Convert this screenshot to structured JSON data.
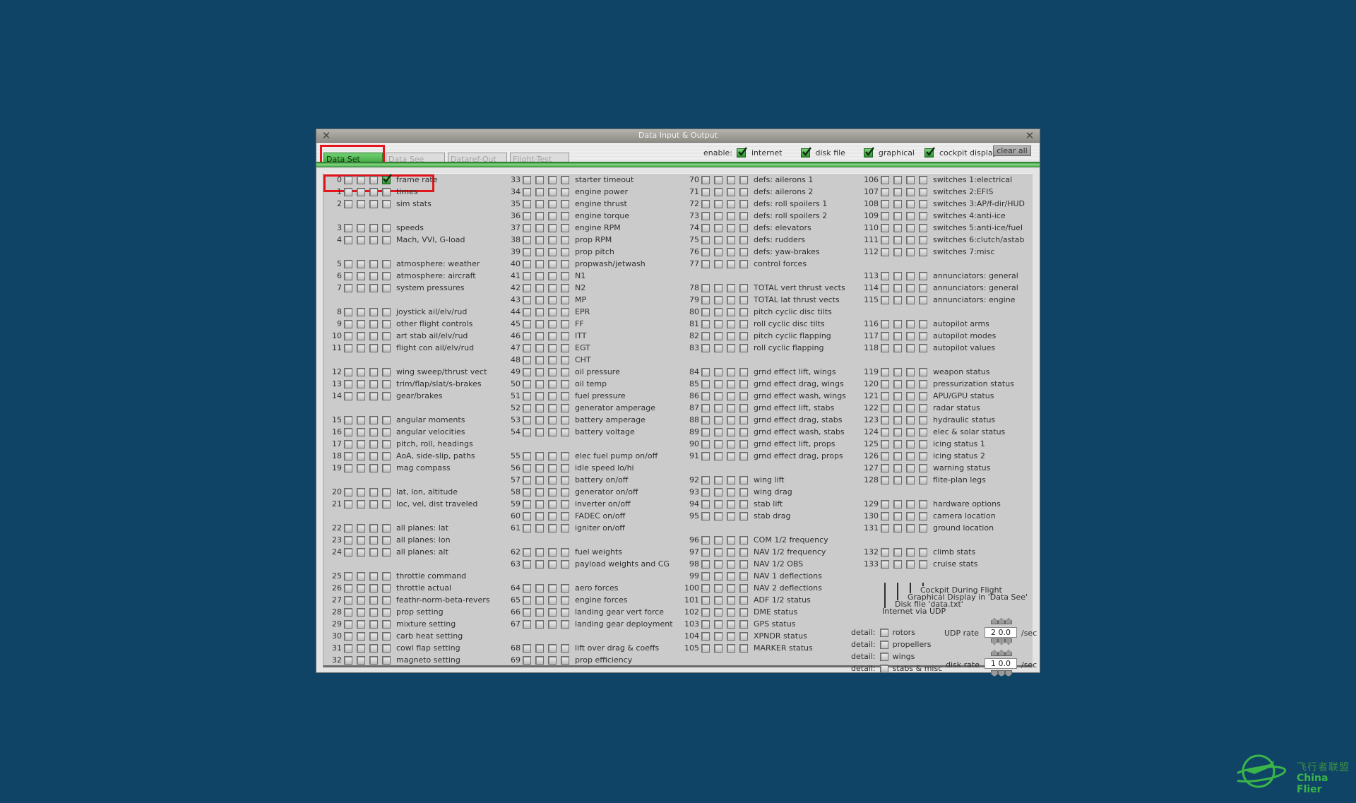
{
  "window": {
    "title": "Data Input & Output",
    "tabs": [
      {
        "label": "Data Set",
        "active": true
      },
      {
        "label": "Data See",
        "active": false
      },
      {
        "label": "Dataref-Out",
        "active": false
      },
      {
        "label": "Flight-Test",
        "active": false
      }
    ],
    "enable_label": "enable:",
    "enable_options": [
      {
        "label": "internet",
        "checked": true
      },
      {
        "label": "disk file",
        "checked": true
      },
      {
        "label": "graphical",
        "checked": true
      },
      {
        "label": "cockpit display",
        "checked": true
      }
    ],
    "clear_all_label": "clear all"
  },
  "columns": [
    {
      "slots": [
        {
          "n": "0",
          "label": "frame rate",
          "checked": [
            false,
            false,
            false,
            true
          ]
        },
        {
          "n": "1",
          "label": "times"
        },
        {
          "n": "2",
          "label": "sim stats"
        },
        null,
        {
          "n": "3",
          "label": "speeds"
        },
        {
          "n": "4",
          "label": "Mach, VVI, G-load"
        },
        null,
        {
          "n": "5",
          "label": "atmosphere: weather"
        },
        {
          "n": "6",
          "label": "atmosphere: aircraft"
        },
        {
          "n": "7",
          "label": "system pressures"
        },
        null,
        {
          "n": "8",
          "label": "joystick ail/elv/rud"
        },
        {
          "n": "9",
          "label": "other flight controls"
        },
        {
          "n": "10",
          "label": "art stab ail/elv/rud"
        },
        {
          "n": "11",
          "label": "flight con ail/elv/rud"
        },
        null,
        {
          "n": "12",
          "label": "wing sweep/thrust vect"
        },
        {
          "n": "13",
          "label": "trim/flap/slat/s-brakes"
        },
        {
          "n": "14",
          "label": "gear/brakes"
        },
        null,
        {
          "n": "15",
          "label": "angular moments"
        },
        {
          "n": "16",
          "label": "angular velocities"
        },
        {
          "n": "17",
          "label": "pitch, roll, headings"
        },
        {
          "n": "18",
          "label": "AoA, side-slip, paths"
        },
        {
          "n": "19",
          "label": "mag compass"
        },
        null,
        {
          "n": "20",
          "label": "lat, lon, altitude"
        },
        {
          "n": "21",
          "label": "loc, vel, dist traveled"
        },
        null,
        {
          "n": "22",
          "label": "all planes: lat"
        },
        {
          "n": "23",
          "label": "all planes: lon"
        },
        {
          "n": "24",
          "label": "all planes: alt"
        },
        null,
        {
          "n": "25",
          "label": "throttle command"
        },
        {
          "n": "26",
          "label": "throttle actual"
        },
        {
          "n": "27",
          "label": "feathr-norm-beta-revers"
        },
        {
          "n": "28",
          "label": "prop setting"
        },
        {
          "n": "29",
          "label": "mixture setting"
        },
        {
          "n": "30",
          "label": "carb heat setting"
        },
        {
          "n": "31",
          "label": "cowl flap setting"
        },
        {
          "n": "32",
          "label": "magneto setting"
        }
      ]
    },
    {
      "slots": [
        {
          "n": "33",
          "label": "starter timeout"
        },
        {
          "n": "34",
          "label": "engine power"
        },
        {
          "n": "35",
          "label": "engine thrust"
        },
        {
          "n": "36",
          "label": "engine torque"
        },
        {
          "n": "37",
          "label": "engine RPM"
        },
        {
          "n": "38",
          "label": "prop RPM"
        },
        {
          "n": "39",
          "label": "prop pitch"
        },
        {
          "n": "40",
          "label": "propwash/jetwash"
        },
        {
          "n": "41",
          "label": "N1"
        },
        {
          "n": "42",
          "label": "N2"
        },
        {
          "n": "43",
          "label": "MP"
        },
        {
          "n": "44",
          "label": "EPR"
        },
        {
          "n": "45",
          "label": "FF"
        },
        {
          "n": "46",
          "label": "ITT"
        },
        {
          "n": "47",
          "label": "EGT"
        },
        {
          "n": "48",
          "label": "CHT"
        },
        {
          "n": "49",
          "label": "oil pressure"
        },
        {
          "n": "50",
          "label": "oil temp"
        },
        {
          "n": "51",
          "label": "fuel pressure"
        },
        {
          "n": "52",
          "label": "generator amperage"
        },
        {
          "n": "53",
          "label": "battery amperage"
        },
        {
          "n": "54",
          "label": "battery voltage"
        },
        null,
        {
          "n": "55",
          "label": "elec fuel pump on/off"
        },
        {
          "n": "56",
          "label": "idle speed lo/hi"
        },
        {
          "n": "57",
          "label": "battery on/off"
        },
        {
          "n": "58",
          "label": "generator on/off"
        },
        {
          "n": "59",
          "label": "inverter on/off"
        },
        {
          "n": "60",
          "label": "FADEC on/off"
        },
        {
          "n": "61",
          "label": "igniter on/off"
        },
        null,
        {
          "n": "62",
          "label": "fuel weights"
        },
        {
          "n": "63",
          "label": "payload weights and CG"
        },
        null,
        {
          "n": "64",
          "label": "aero forces"
        },
        {
          "n": "65",
          "label": "engine forces"
        },
        {
          "n": "66",
          "label": "landing gear vert force"
        },
        {
          "n": "67",
          "label": "landing gear deployment"
        },
        null,
        {
          "n": "68",
          "label": "lift over drag & coeffs"
        },
        {
          "n": "69",
          "label": "prop efficiency"
        }
      ]
    },
    {
      "slots": [
        {
          "n": "70",
          "label": "defs: ailerons 1"
        },
        {
          "n": "71",
          "label": "defs: ailerons 2"
        },
        {
          "n": "72",
          "label": "defs: roll spoilers 1"
        },
        {
          "n": "73",
          "label": "defs: roll spoilers 2"
        },
        {
          "n": "74",
          "label": "defs: elevators"
        },
        {
          "n": "75",
          "label": "defs: rudders"
        },
        {
          "n": "76",
          "label": "defs: yaw-brakes"
        },
        {
          "n": "77",
          "label": "control forces"
        },
        null,
        {
          "n": "78",
          "label": "TOTAL vert thrust vects"
        },
        {
          "n": "79",
          "label": "TOTAL lat  thrust vects"
        },
        {
          "n": "80",
          "label": "pitch cyclic disc tilts"
        },
        {
          "n": "81",
          "label": "roll cyclic disc tilts"
        },
        {
          "n": "82",
          "label": "pitch cyclic flapping"
        },
        {
          "n": "83",
          "label": "roll cyclic flapping"
        },
        null,
        {
          "n": "84",
          "label": "grnd effect lift, wings"
        },
        {
          "n": "85",
          "label": "grnd effect drag, wings"
        },
        {
          "n": "86",
          "label": "grnd effect wash, wings"
        },
        {
          "n": "87",
          "label": "grnd effect lift, stabs"
        },
        {
          "n": "88",
          "label": "grnd effect drag, stabs"
        },
        {
          "n": "89",
          "label": "grnd effect wash, stabs"
        },
        {
          "n": "90",
          "label": "grnd effect lift, props"
        },
        {
          "n": "91",
          "label": "grnd effect drag, props"
        },
        null,
        {
          "n": "92",
          "label": "wing lift"
        },
        {
          "n": "93",
          "label": "wing drag"
        },
        {
          "n": "94",
          "label": "stab lift"
        },
        {
          "n": "95",
          "label": "stab drag"
        },
        null,
        {
          "n": "96",
          "label": "COM 1/2 frequency"
        },
        {
          "n": "97",
          "label": "NAV 1/2 frequency"
        },
        {
          "n": "98",
          "label": "NAV 1/2 OBS"
        },
        {
          "n": "99",
          "label": "NAV 1 deflections"
        },
        {
          "n": "100",
          "label": "NAV 2 deflections"
        },
        {
          "n": "101",
          "label": "ADF 1/2 status"
        },
        {
          "n": "102",
          "label": "DME status"
        },
        {
          "n": "103",
          "label": "GPS status"
        },
        {
          "n": "104",
          "label": "XPNDR status"
        },
        {
          "n": "105",
          "label": "MARKER status"
        }
      ]
    },
    {
      "slots": [
        {
          "n": "106",
          "label": "switches 1:electrical"
        },
        {
          "n": "107",
          "label": "switches 2:EFIS"
        },
        {
          "n": "108",
          "label": "switches 3:AP/f-dir/HUD"
        },
        {
          "n": "109",
          "label": "switches 4:anti-ice"
        },
        {
          "n": "110",
          "label": "switches 5:anti-ice/fuel"
        },
        {
          "n": "111",
          "label": "switches 6:clutch/astab"
        },
        {
          "n": "112",
          "label": "switches 7:misc"
        },
        null,
        {
          "n": "113",
          "label": "annunciators: general"
        },
        {
          "n": "114",
          "label": "annunciators: general"
        },
        {
          "n": "115",
          "label": "annunciators: engine"
        },
        null,
        {
          "n": "116",
          "label": "autopilot arms"
        },
        {
          "n": "117",
          "label": "autopilot modes"
        },
        {
          "n": "118",
          "label": "autopilot values"
        },
        null,
        {
          "n": "119",
          "label": "weapon status"
        },
        {
          "n": "120",
          "label": "pressurization status"
        },
        {
          "n": "121",
          "label": "APU/GPU status"
        },
        {
          "n": "122",
          "label": "radar status"
        },
        {
          "n": "123",
          "label": "hydraulic status"
        },
        {
          "n": "124",
          "label": "elec & solar status"
        },
        {
          "n": "125",
          "label": "icing status 1"
        },
        {
          "n": "126",
          "label": "icing status 2"
        },
        {
          "n": "127",
          "label": "warning status"
        },
        {
          "n": "128",
          "label": "flite-plan legs"
        },
        null,
        {
          "n": "129",
          "label": "hardware options"
        },
        {
          "n": "130",
          "label": "camera location"
        },
        {
          "n": "131",
          "label": "ground location"
        },
        null,
        {
          "n": "132",
          "label": "climb stats"
        },
        {
          "n": "133",
          "label": "cruise stats"
        }
      ]
    }
  ],
  "legend": {
    "cockpit": "Cockpit During Flight",
    "graphical": "Graphical Display in 'Data See'",
    "disk": "Disk file 'data.txt'",
    "internet": "Internet via UDP"
  },
  "details": [
    {
      "prefix": "detail:",
      "label": "rotors",
      "checked": false
    },
    {
      "prefix": "detail:",
      "label": "propellers",
      "checked": false
    },
    {
      "prefix": "detail:",
      "label": "wings",
      "checked": false
    },
    {
      "prefix": "detail:",
      "label": "stabs & misc",
      "checked": false
    }
  ],
  "rates": {
    "udp_label": "UDP rate",
    "udp_value": "2 0.0",
    "disk_label": "disk rate",
    "disk_value": "1 0.0",
    "unit": "/sec"
  },
  "watermark": {
    "cn": "飞行者联盟",
    "en": "China Flier"
  }
}
